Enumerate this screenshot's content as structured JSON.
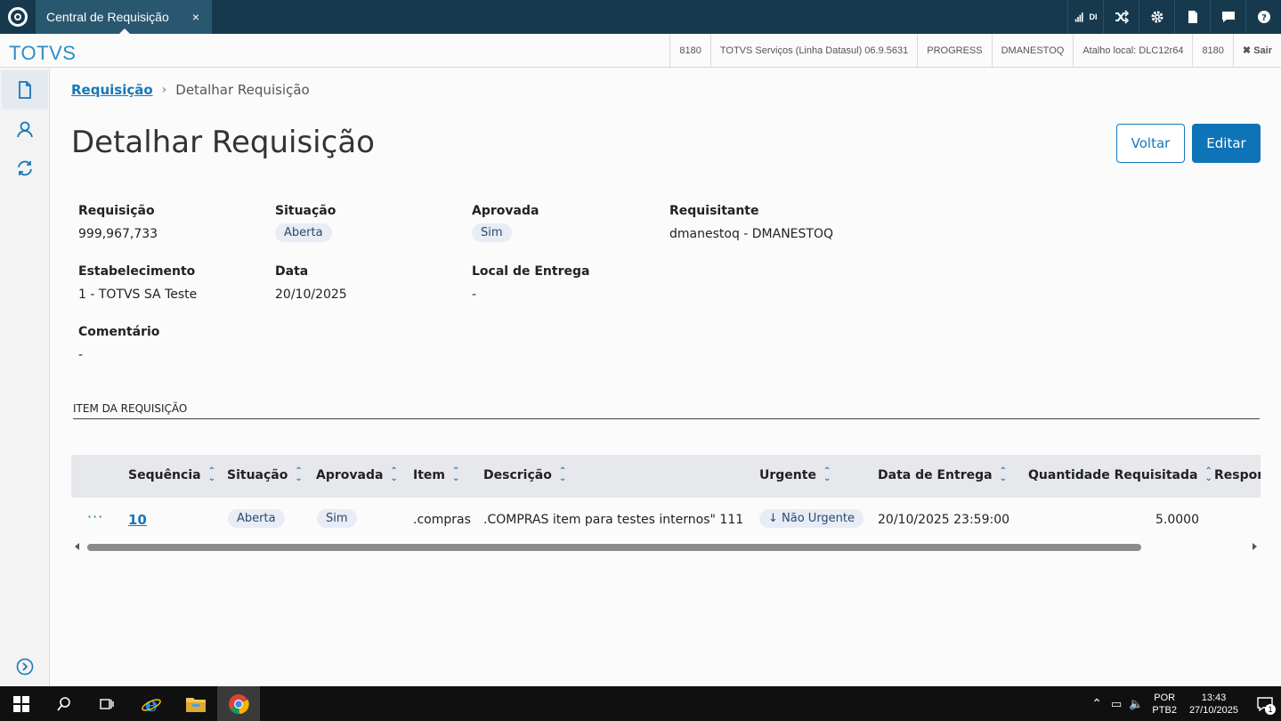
{
  "topbar": {
    "tab_title": "Central de Requisição",
    "tab_close": "×",
    "signal_label": "DI"
  },
  "infobar": {
    "brand": "TOTVS",
    "items": [
      "8180",
      "TOTVS Serviços (Linha Datasul) 06.9.5631",
      "PROGRESS",
      "DMANESTOQ",
      "Atalho local: DLC12r64",
      "8180"
    ],
    "logout": "✖ Sair"
  },
  "breadcrumb": {
    "parent": "Requisição",
    "separator": "›",
    "current": "Detalhar Requisição"
  },
  "page": {
    "title": "Detalhar Requisição",
    "back_label": "Voltar",
    "edit_label": "Editar"
  },
  "details": {
    "requisicao_label": "Requisição",
    "requisicao_value": "999,967,733",
    "situacao_label": "Situação",
    "situacao_value": "Aberta",
    "aprovada_label": "Aprovada",
    "aprovada_value": "Sim",
    "requisitante_label": "Requisitante",
    "requisitante_value": "dmanestoq - DMANESTOQ",
    "estabelecimento_label": "Estabelecimento",
    "estabelecimento_value": "1 - TOTVS SA Teste",
    "data_label": "Data",
    "data_value": "20/10/2025",
    "local_label": "Local de Entrega",
    "local_value": "-",
    "comentario_label": "Comentário",
    "comentario_value": "-"
  },
  "items_section": {
    "title": "ITEM DA REQUISIÇÃO",
    "headers": [
      "Sequência",
      "Situação",
      "Aprovada",
      "Item",
      "Descrição",
      "Urgente",
      "Data de Entrega",
      "Quantidade Requisitada",
      "Respon"
    ],
    "row": {
      "actions": "···",
      "sequencia": "10",
      "situacao": "Aberta",
      "aprovada": "Sim",
      "item": ".compras",
      "descricao": ".COMPRAS item para testes internos\" 111",
      "urgente": "↓ Não Urgente",
      "data_entrega": "20/10/2025 23:59:00",
      "quantidade": "5.0000"
    }
  },
  "taskbar": {
    "lang_top": "POR",
    "lang_bottom": "PTB2",
    "time": "13:43",
    "date": "27/10/2025",
    "notifications": "1"
  },
  "colors": {
    "topbar": "#17394e",
    "accent": "#1678b8",
    "primary_button": "#0f73b7",
    "brand": "#2a8fc7"
  }
}
